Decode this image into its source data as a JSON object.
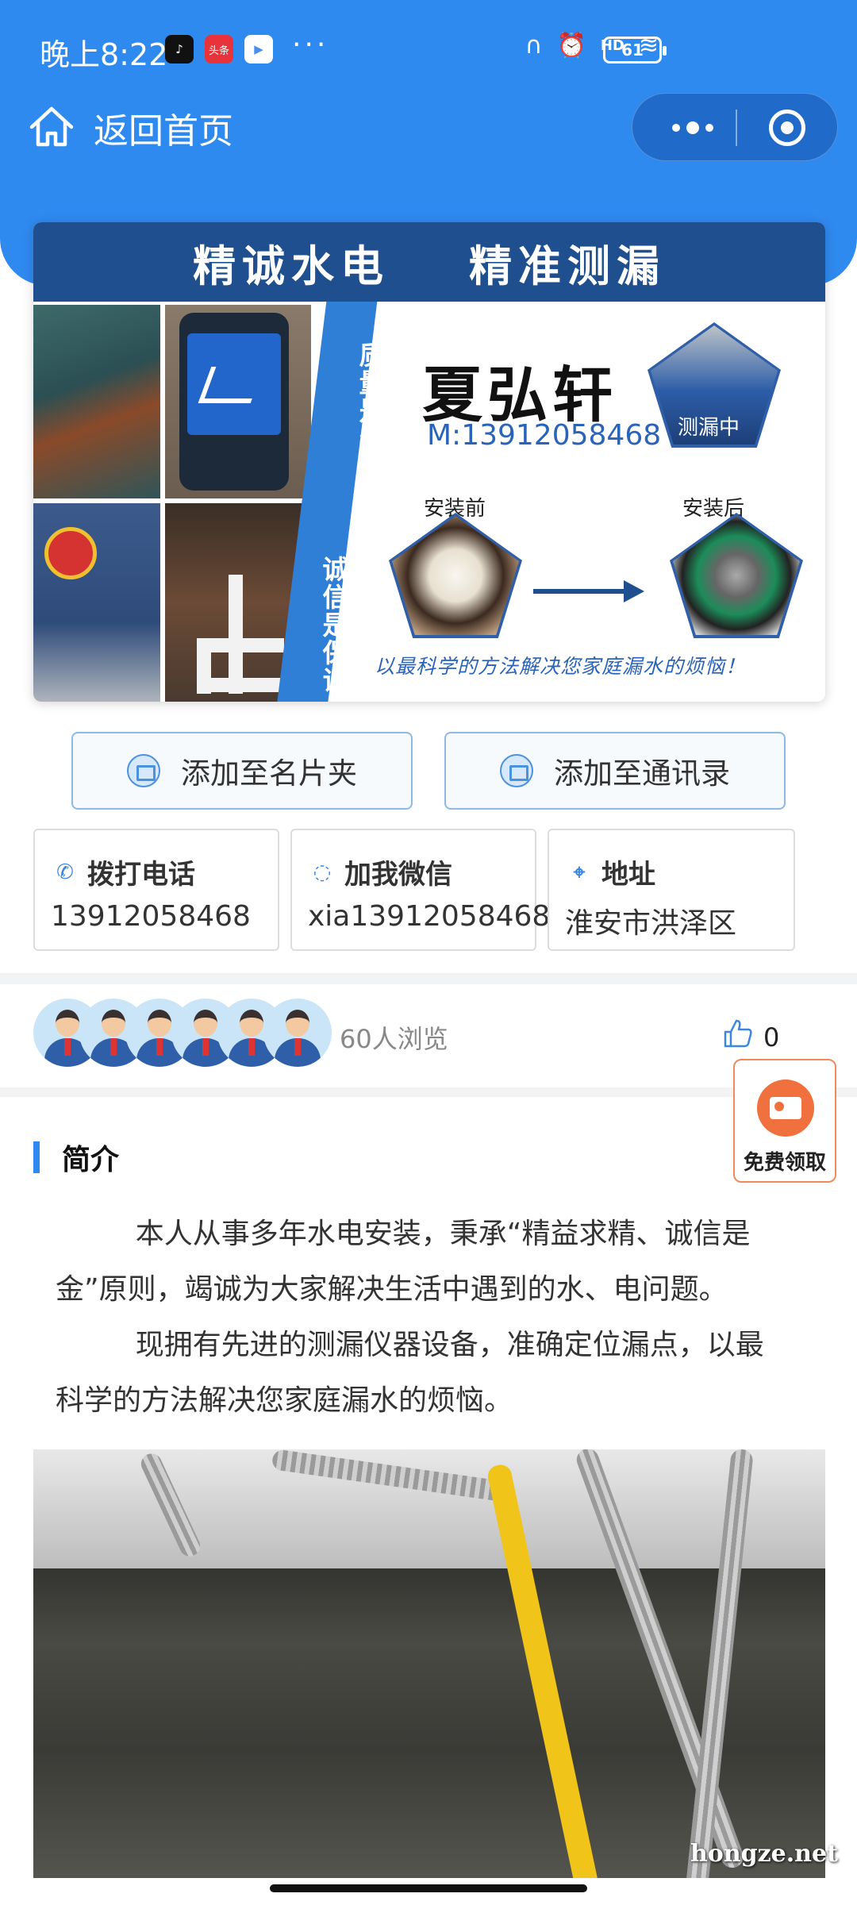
{
  "status": {
    "time": "晚上8:22",
    "app_icons": [
      "tiktok-icon",
      "toutiao-icon",
      "play-icon"
    ],
    "app_icon_label": "头条",
    "more": "···",
    "signal": "HD",
    "battery": "61"
  },
  "nav": {
    "back_home_label": "返回首页"
  },
  "banner": {
    "headline_left": "精诚水电",
    "headline_right": "精准测漏",
    "strip_text_top": "质量是生命，",
    "strip_text_bottom": "诚信是保证",
    "name": "夏弘轩",
    "phone": "M:13912058468",
    "worker_label": "测漏中",
    "before_label": "安装前",
    "after_label": "安装后",
    "slogan": "以最科学的方法解决您家庭漏水的烦恼！"
  },
  "actions": {
    "add_to_cardholder": "添加至名片夹",
    "add_to_contacts": "添加至通讯录"
  },
  "contacts": [
    {
      "label": "拨打电话",
      "value": "13912058468",
      "icon": "phone-icon"
    },
    {
      "label": "加我微信",
      "value": "xia13912058468",
      "icon": "wechat-icon"
    },
    {
      "label": "地址",
      "value": "淮安市洪泽区",
      "icon": "location-icon"
    }
  ],
  "visitors": {
    "view_text": "60人浏览",
    "likes": "0",
    "avatar_count": 6
  },
  "free_widget": {
    "label": "免费领取"
  },
  "intro": {
    "title": "简介",
    "paragraph1": "本人从事多年水电安装，秉承“精益求精、诚信是金”原则，竭诚为大家解决生活中遇到的水、电问题。",
    "paragraph2": "现拥有先进的测漏仪器设备，准确定位漏点，以最科学的方法解决您家庭漏水的烦恼。"
  },
  "watermark": "hongze.net",
  "colors": {
    "primary": "#2f8af0",
    "banner_dark": "#1f4f8f",
    "accent_orange": "#f0703e"
  }
}
